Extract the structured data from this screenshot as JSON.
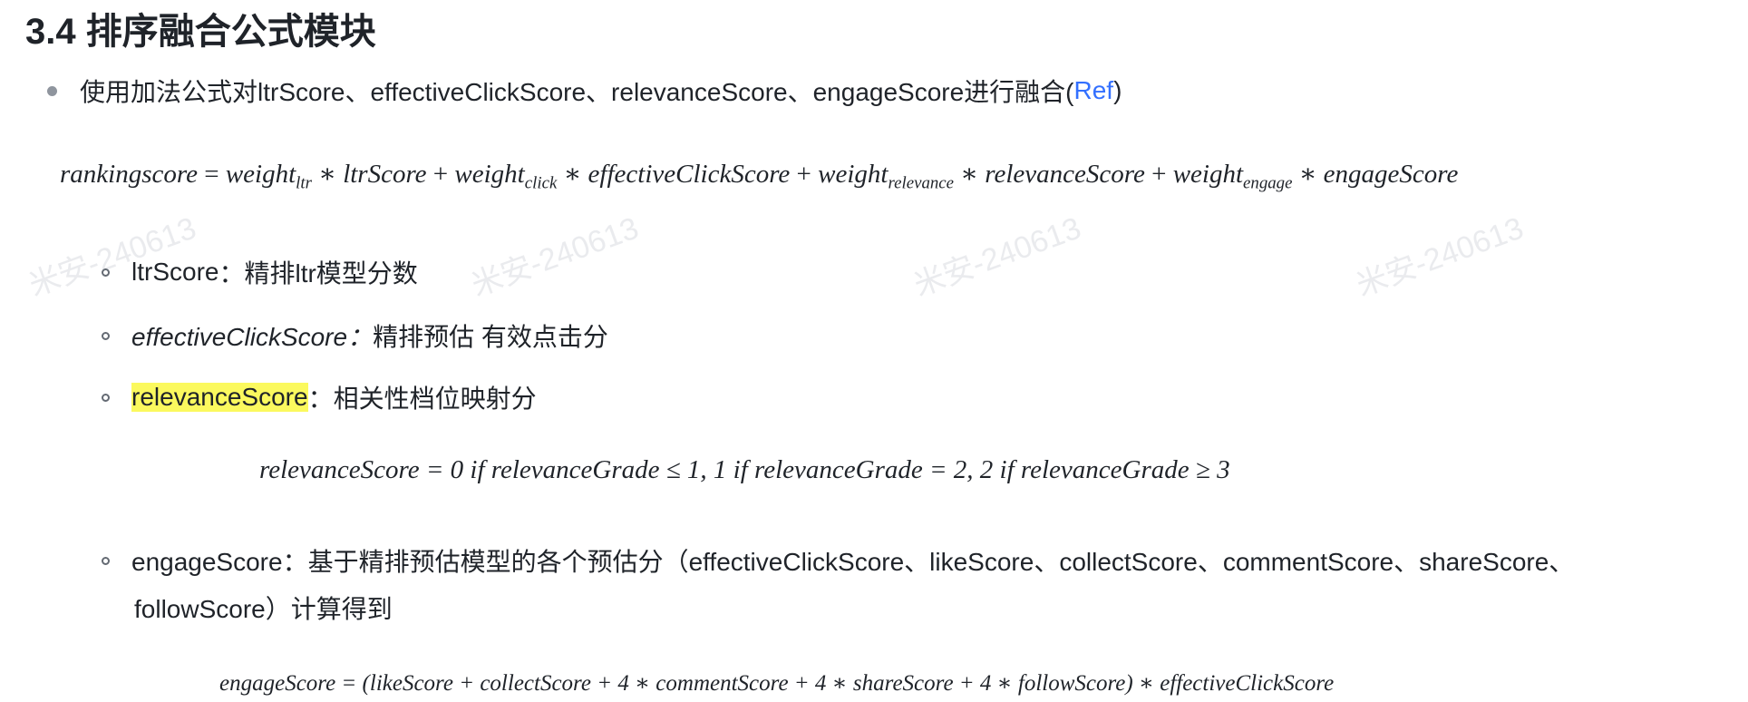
{
  "watermark": "米安-240613",
  "section": {
    "title": "3.4 排序融合公式模块"
  },
  "intro": {
    "text": "使用加法公式对ltrScore、effectiveClickScore、relevanceScore、engageScore进行融合(",
    "link": "Ref",
    "tail": ")"
  },
  "formulas": {
    "main": {
      "lhs": "rankingscore",
      "t1_w": "weight",
      "t1_sub": "ltr",
      "t1_x": "ltrScore",
      "t2_w": "weight",
      "t2_sub": "click",
      "t2_x": "effectiveClickScore",
      "t3_w": "weight",
      "t3_sub": "relevance",
      "t3_x": "relevanceScore",
      "t4_w": "weight",
      "t4_sub": "engage",
      "t4_x": "engageScore"
    },
    "relevance": "relevanceScore = 0 if relevanceGrade ≤ 1,  1 if relevanceGrade = 2,  2 if relevanceGrade ≥ 3",
    "engage": "engageScore = (likeScore + collectScore + 4 ∗ commentScore + 4 ∗ shareScore + 4 ∗ followScore) ∗ effectiveClickScore"
  },
  "items": [
    {
      "term": "ltrScore",
      "desc": "：精排ltr模型分数"
    },
    {
      "term": "effectiveClickScore：",
      "desc": "精排预估 有效点击分"
    },
    {
      "term": "relevanceScore",
      "desc": "：相关性档位映射分"
    },
    {
      "line1": "engageScore：基于精排预估模型的各个预估分（effectiveClickScore、likeScore、collectScore、commentScore、shareScore、",
      "line2": "followScore）计算得到"
    }
  ],
  "colors": {
    "link": "#3370ff",
    "highlight": "#fbf95e",
    "text": "#1f2329"
  }
}
